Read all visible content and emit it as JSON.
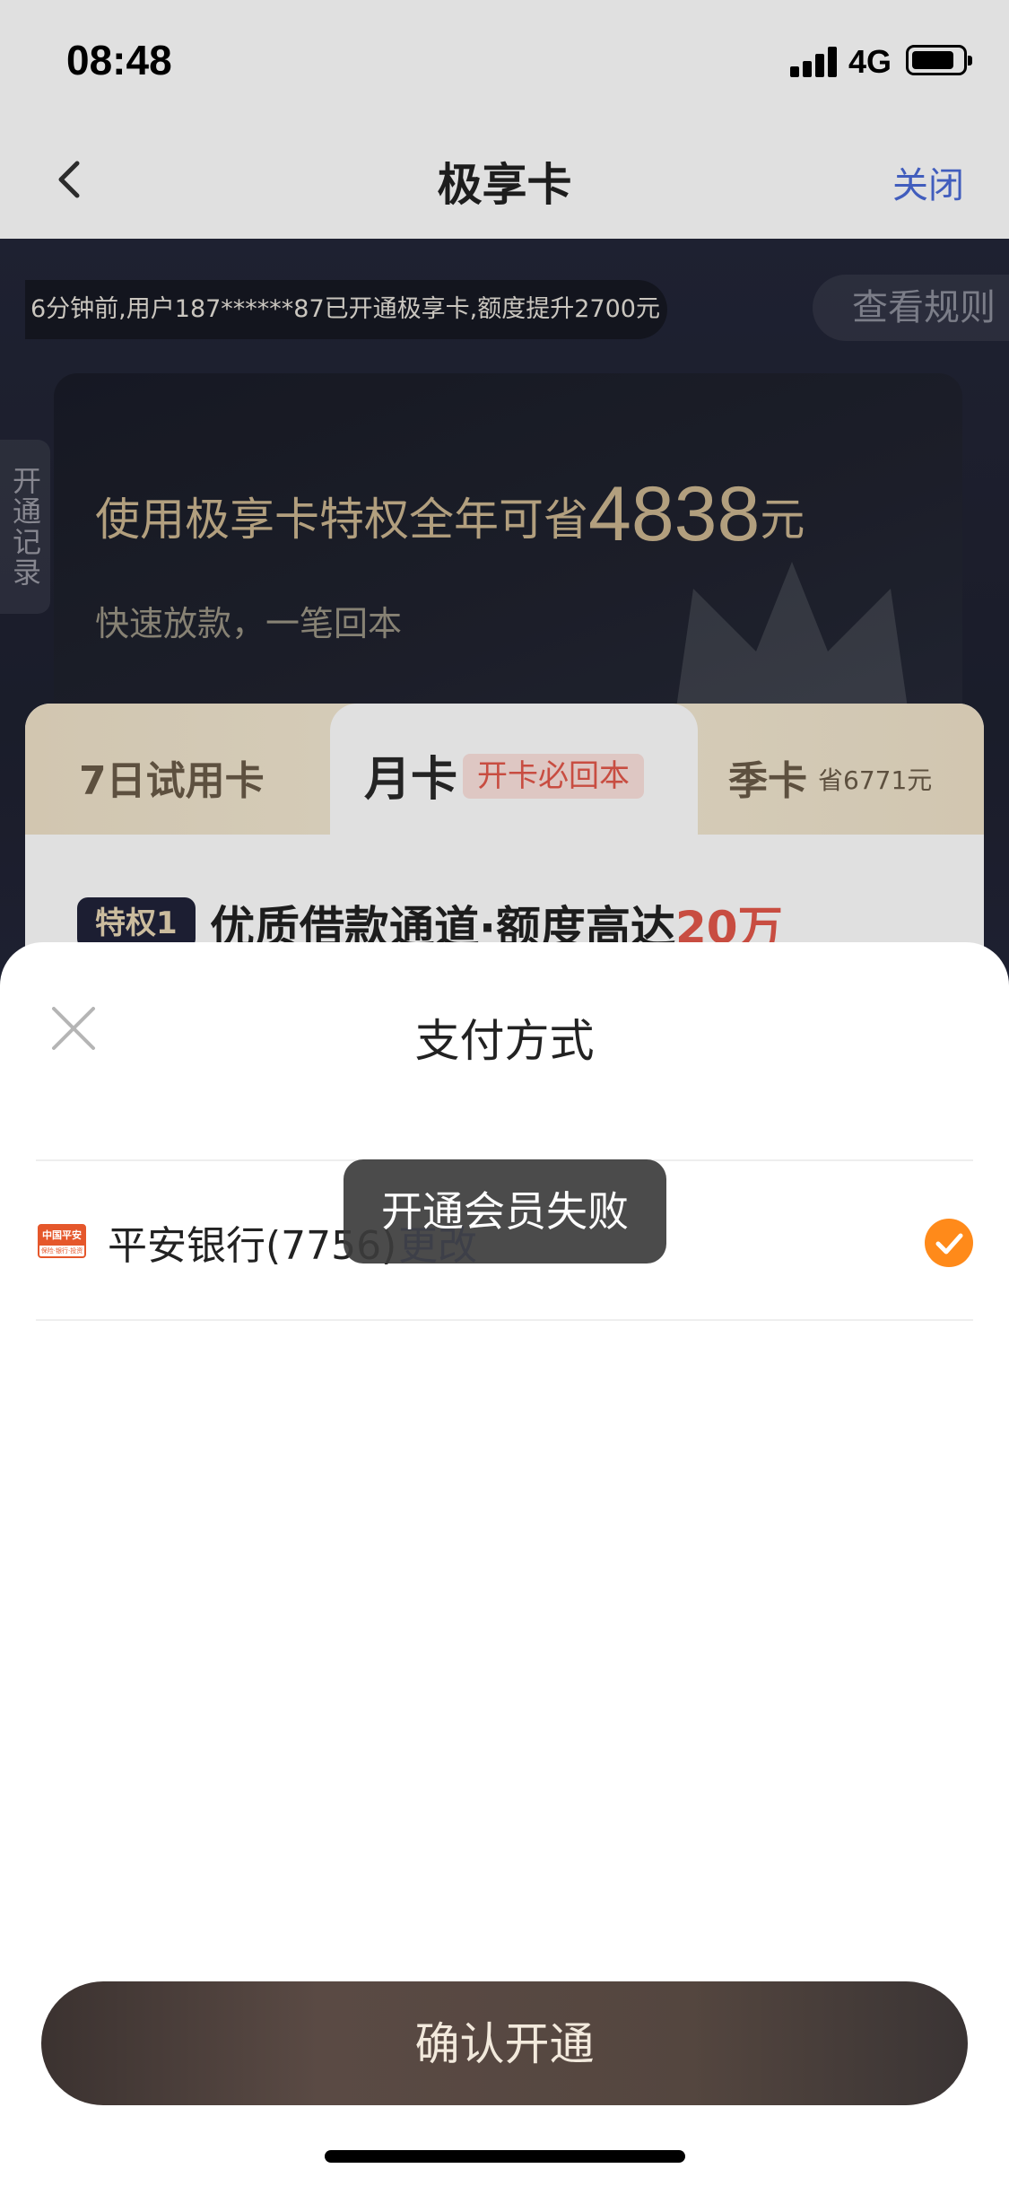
{
  "status_bar": {
    "time": "08:48",
    "network": "4G",
    "icons": [
      "signal-icon",
      "battery-icon"
    ]
  },
  "nav": {
    "title": "极享卡",
    "close_label": "关闭",
    "back_icon": "chevron-left-icon",
    "title_color": "#222222",
    "close_color": "#4a6ad8"
  },
  "hero": {
    "ticker": "6分钟前,用户187******87已开通极享卡,额度提升2700元",
    "rules_label": "查看规则",
    "records_label": "开通记录",
    "headline_prefix": "使用极享卡特权全年可省",
    "headline_amount": "4838",
    "headline_unit": "元",
    "subline": "快速放款，一笔回本",
    "accent_color": "#cbb690"
  },
  "plans": {
    "tabs": [
      {
        "label": "7日试用卡",
        "selected": false
      },
      {
        "label": "月卡",
        "badge": "开卡必回本",
        "selected": true
      },
      {
        "label": "季卡",
        "note": "省6771元",
        "selected": false
      }
    ],
    "privilege": {
      "tag": "特权1",
      "text": "优质借款通道·额度高达",
      "highlight": "20万",
      "highlight_color": "#e4584a"
    }
  },
  "payment_sheet": {
    "title": "支付方式",
    "close_icon": "close-icon",
    "method": {
      "bank_logo_icon": "ping-an-bank-logo",
      "logo_text": "中国平安",
      "logo_sub": "保险·银行·投资",
      "label": "平安银行(7756)",
      "change_label": "更改",
      "selected": true,
      "check_color": "#ff8a1a"
    }
  },
  "toast": {
    "message": "开通会员失败"
  },
  "confirm": {
    "label": "确认开通"
  }
}
